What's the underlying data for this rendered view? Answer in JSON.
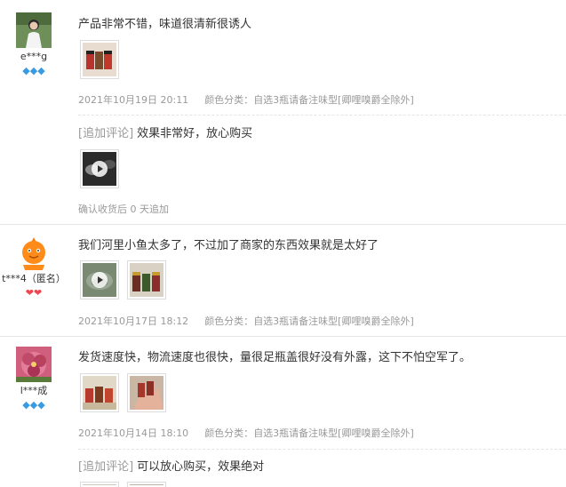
{
  "reviews": [
    {
      "username": "e***g",
      "badges": "💎💎💎",
      "text": "产品非常不错，味道很清新很诱人",
      "date": "2021年10月19日 20:11",
      "sku_label": "颜色分类：",
      "sku_value": "自选3瓶请备注味型[卿哩嗅爵全除外]",
      "append_tag": "[追加评论]",
      "append_text": "效果非常好，放心购买",
      "append_meta": "确认收货后 0 天追加"
    },
    {
      "username": "t***4（匿名）",
      "badges": "❤❤",
      "text": "我们河里小鱼太多了，不过加了商家的东西效果就是太好了",
      "date": "2021年10月17日 18:12",
      "sku_label": "颜色分类：",
      "sku_value": "自选3瓶请备注味型[卿哩嗅爵全除外]"
    },
    {
      "username": "l***成",
      "badges": "💎💎💎",
      "text": "发货速度快，物流速度也很快，量很足瓶盖很好没有外露，这下不怕空军了。",
      "date": "2021年10月14日 18:10",
      "sku_label": "颜色分类：",
      "sku_value": "自选3瓶请备注味型[卿哩嗅爵全除外]",
      "append_tag": "[追加评论]",
      "append_text": "可以放心购买，效果绝对"
    }
  ],
  "icons": {
    "diamond": "diamond-icon",
    "heart": "heart-icon",
    "play": "play-icon"
  },
  "colors": {
    "meta_text": "#999999",
    "diamond": "#3a9be0",
    "heart": "#f0474f"
  }
}
